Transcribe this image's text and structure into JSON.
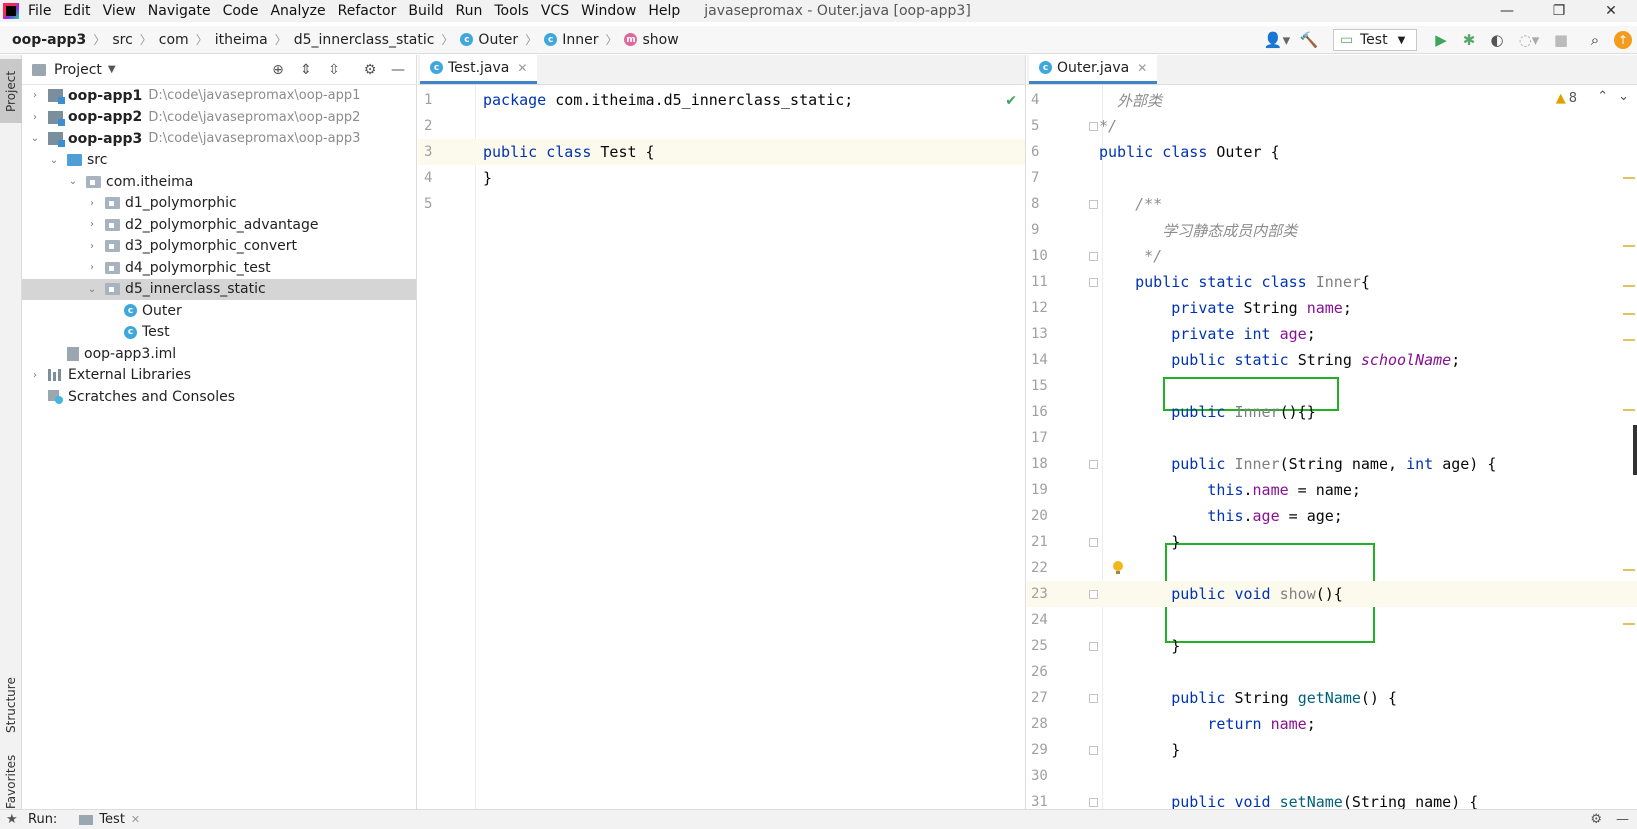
{
  "menu": {
    "items": [
      "File",
      "Edit",
      "View",
      "Navigate",
      "Code",
      "Analyze",
      "Refactor",
      "Build",
      "Run",
      "Tools",
      "VCS",
      "Window",
      "Help"
    ],
    "window_title": "javasepromax - Outer.java [oop-app3]"
  },
  "window_controls": {
    "minimize": "—",
    "restore": "❐",
    "close": "✕"
  },
  "breadcrumb": {
    "project": "oop-app3",
    "src": "src",
    "com": "com",
    "itheima": "itheima",
    "package": "d5_innerclass_static",
    "outer": "Outer",
    "inner": "Inner",
    "method": "show"
  },
  "toolbar": {
    "run_config": "Test"
  },
  "left_stripe": {
    "project": "Project",
    "structure": "Structure",
    "favorites": "Favorites"
  },
  "project_panel": {
    "title": "Project",
    "tree": [
      {
        "indent": 0,
        "twisty": "›",
        "icon": "module",
        "name": "oop-app1",
        "bold": true,
        "path": "D:\\code\\javasepromax\\oop-app1"
      },
      {
        "indent": 0,
        "twisty": "›",
        "icon": "module",
        "name": "oop-app2",
        "bold": true,
        "path": "D:\\code\\javasepromax\\oop-app2"
      },
      {
        "indent": 0,
        "twisty": "⌄",
        "icon": "module",
        "name": "oop-app3",
        "bold": true,
        "path": "D:\\code\\javasepromax\\oop-app3"
      },
      {
        "indent": 1,
        "twisty": "⌄",
        "icon": "src",
        "name": "src",
        "bold": false,
        "path": ""
      },
      {
        "indent": 2,
        "twisty": "⌄",
        "icon": "package",
        "name": "com.itheima",
        "bold": false,
        "path": ""
      },
      {
        "indent": 3,
        "twisty": "›",
        "icon": "package",
        "name": "d1_polymorphic",
        "bold": false,
        "path": ""
      },
      {
        "indent": 3,
        "twisty": "›",
        "icon": "package",
        "name": "d2_polymorphic_advantage",
        "bold": false,
        "path": ""
      },
      {
        "indent": 3,
        "twisty": "›",
        "icon": "package",
        "name": "d3_polymorphic_convert",
        "bold": false,
        "path": ""
      },
      {
        "indent": 3,
        "twisty": "›",
        "icon": "package",
        "name": "d4_polymorphic_test",
        "bold": false,
        "path": ""
      },
      {
        "indent": 3,
        "twisty": "⌄",
        "icon": "package",
        "name": "d5_innerclass_static",
        "bold": false,
        "path": "",
        "selected": true
      },
      {
        "indent": 4,
        "twisty": "",
        "icon": "class",
        "name": "Outer",
        "bold": false,
        "path": ""
      },
      {
        "indent": 4,
        "twisty": "",
        "icon": "class",
        "name": "Test",
        "bold": false,
        "path": ""
      },
      {
        "indent": 1,
        "twisty": "",
        "icon": "iml",
        "name": "oop-app3.iml",
        "bold": false,
        "path": ""
      },
      {
        "indent": 0,
        "twisty": "›",
        "icon": "library",
        "name": "External Libraries",
        "bold": false,
        "path": ""
      },
      {
        "indent": 0,
        "twisty": "",
        "icon": "scratch",
        "name": "Scratches and Consoles",
        "bold": false,
        "path": ""
      }
    ]
  },
  "editor_left": {
    "tab": "Test.java",
    "lines": [
      {
        "n": "1",
        "t": [
          [
            "kw",
            "package "
          ],
          [
            "id",
            "com.itheima.d5_innerclass_static;"
          ]
        ]
      },
      {
        "n": "2",
        "t": []
      },
      {
        "n": "3",
        "t": [
          [
            "kw",
            "public class "
          ],
          [
            "id",
            "Test {"
          ]
        ],
        "cur": true
      },
      {
        "n": "4",
        "t": [
          [
            "id",
            "}"
          ]
        ]
      },
      {
        "n": "5",
        "t": []
      }
    ]
  },
  "editor_right": {
    "tab": "Outer.java",
    "warnings": "8",
    "lines": [
      {
        "n": "4",
        "t": [
          [
            "cm",
            "  外部类"
          ]
        ]
      },
      {
        "n": "5",
        "t": [
          [
            "cm",
            "*/"
          ]
        ]
      },
      {
        "n": "6",
        "t": [
          [
            "kw",
            "public class "
          ],
          [
            "id",
            "Outer {"
          ]
        ]
      },
      {
        "n": "7",
        "t": []
      },
      {
        "n": "8",
        "t": [
          [
            "cm",
            "    /**"
          ]
        ]
      },
      {
        "n": "9",
        "t": [
          [
            "cm",
            "       学习静态成员内部类"
          ]
        ]
      },
      {
        "n": "10",
        "t": [
          [
            "cm",
            "     */"
          ]
        ]
      },
      {
        "n": "11",
        "t": [
          [
            "kw",
            "    public static class "
          ],
          [
            "un",
            "Inner"
          ],
          [
            "id",
            "{"
          ]
        ]
      },
      {
        "n": "12",
        "t": [
          [
            "kw",
            "        private "
          ],
          [
            "id",
            "String "
          ],
          [
            "fld",
            "name"
          ],
          [
            "id",
            ";"
          ]
        ]
      },
      {
        "n": "13",
        "t": [
          [
            "kw",
            "        private int "
          ],
          [
            "fld",
            "age"
          ],
          [
            "id",
            ";"
          ]
        ]
      },
      {
        "n": "14",
        "t": [
          [
            "kw",
            "        public static "
          ],
          [
            "id",
            "String "
          ],
          [
            "st",
            "schoolName"
          ],
          [
            "id",
            ";"
          ]
        ]
      },
      {
        "n": "15",
        "t": []
      },
      {
        "n": "16",
        "t": [
          [
            "kw",
            "        public "
          ],
          [
            "un",
            "Inner"
          ],
          [
            "id",
            "(){}"
          ]
        ]
      },
      {
        "n": "17",
        "t": []
      },
      {
        "n": "18",
        "t": [
          [
            "kw",
            "        public "
          ],
          [
            "un",
            "Inner"
          ],
          [
            "id",
            "(String name, "
          ],
          [
            "kw",
            "int "
          ],
          [
            "id",
            "age) {"
          ]
        ]
      },
      {
        "n": "19",
        "t": [
          [
            "kw",
            "            this"
          ],
          [
            "id",
            "."
          ],
          [
            "fld",
            "name"
          ],
          [
            "id",
            " = name;"
          ]
        ]
      },
      {
        "n": "20",
        "t": [
          [
            "kw",
            "            this"
          ],
          [
            "id",
            "."
          ],
          [
            "fld",
            "age"
          ],
          [
            "id",
            " = age;"
          ]
        ]
      },
      {
        "n": "21",
        "t": [
          [
            "id",
            "        }"
          ]
        ]
      },
      {
        "n": "22",
        "t": []
      },
      {
        "n": "23",
        "t": [
          [
            "kw",
            "        public void "
          ],
          [
            "un",
            "show"
          ],
          [
            "id",
            "(){"
          ]
        ],
        "cur": true
      },
      {
        "n": "24",
        "t": []
      },
      {
        "n": "25",
        "t": [
          [
            "id",
            "        }"
          ]
        ]
      },
      {
        "n": "26",
        "t": []
      },
      {
        "n": "27",
        "t": [
          [
            "kw",
            "        public "
          ],
          [
            "id",
            "String "
          ],
          [
            "mth",
            "getName"
          ],
          [
            "id",
            "() {"
          ]
        ]
      },
      {
        "n": "28",
        "t": [
          [
            "kw",
            "            return "
          ],
          [
            "fld",
            "name"
          ],
          [
            "id",
            ";"
          ]
        ]
      },
      {
        "n": "29",
        "t": [
          [
            "id",
            "        }"
          ]
        ]
      },
      {
        "n": "30",
        "t": []
      },
      {
        "n": "31",
        "t": [
          [
            "kw",
            "        public void "
          ],
          [
            "mth",
            "setName"
          ],
          [
            "id",
            "(String name) {"
          ]
        ]
      }
    ]
  },
  "bottom": {
    "run_label": "Run:",
    "run_tab": "Test"
  }
}
